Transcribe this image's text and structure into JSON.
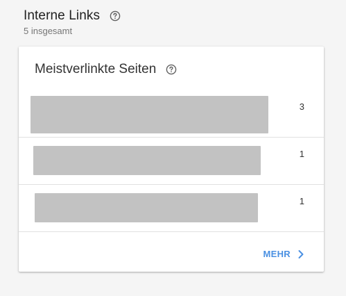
{
  "section": {
    "title": "Interne Links",
    "subtitle": "5 insgesamt",
    "help_icon": "help-circle-icon"
  },
  "card": {
    "title": "Meistverlinkte Seiten",
    "help_icon": "help-circle-icon",
    "rows": [
      {
        "value": "3"
      },
      {
        "value": "1"
      },
      {
        "value": "1"
      }
    ],
    "more_label": "MEHR",
    "more_icon": "chevron-right-icon",
    "accent_color": "#4a90e2",
    "bar_color": "#c2c2c2"
  }
}
